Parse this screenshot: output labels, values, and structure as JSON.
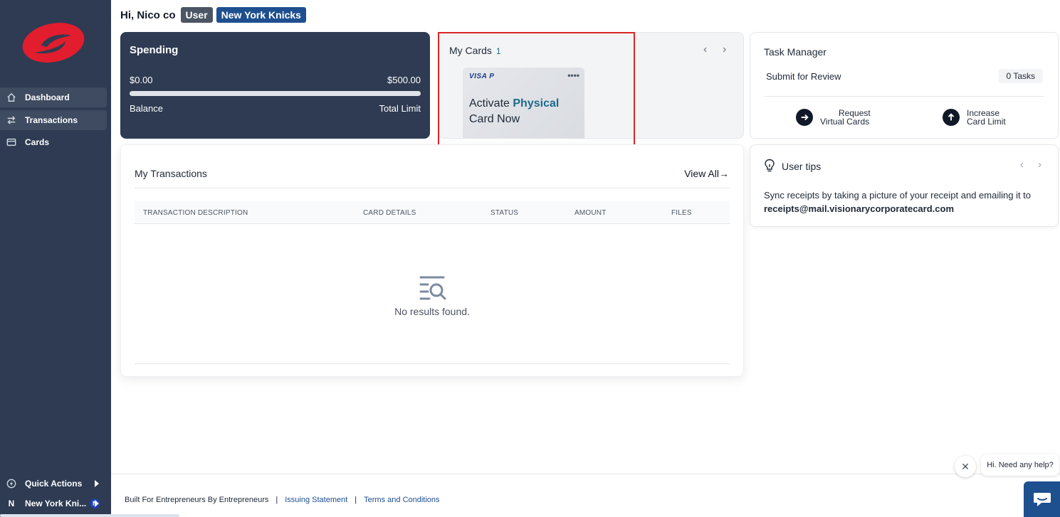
{
  "colors": {
    "sidebar_bg": "#2e3b52",
    "brand_red": "#e11d2e",
    "accent_blue": "#1e4f8f",
    "highlight_red": "#dc2626"
  },
  "sidebar": {
    "items": [
      {
        "label": "Dashboard",
        "icon": "home-icon",
        "active": true
      },
      {
        "label": "Transactions",
        "icon": "transfer-arrows-icon",
        "active": true
      },
      {
        "label": "Cards",
        "icon": "credit-card-icon",
        "active": false
      }
    ],
    "quick_actions": "Quick Actions",
    "org_label": "New York Kni...",
    "org_initial": "N",
    "org_badge": "N"
  },
  "header": {
    "greeting": "Hi, Nico co",
    "role_badge": "User",
    "team_badge": "New York Knicks"
  },
  "spending": {
    "title": "Spending",
    "balance_value": "$0.00",
    "limit_value": "$500.00",
    "balance_label": "Balance",
    "limit_label": "Total Limit",
    "used_fraction": 0
  },
  "my_cards": {
    "title": "My Cards",
    "count": "1",
    "card": {
      "brand": "VISA P",
      "masked": "••••",
      "line1_prefix": "Activate",
      "line1_highlight": "Physical",
      "line2": "Card Now"
    }
  },
  "task_manager": {
    "title": "Task Manager",
    "row_label": "Submit for Review",
    "tasks_count": "0 Tasks",
    "actions": [
      {
        "line1": "Request",
        "line2": "Virtual Cards"
      },
      {
        "line1": "Increase",
        "line2": "Card Limit"
      }
    ]
  },
  "transactions": {
    "title": "My Transactions",
    "view_all": "View All",
    "columns": [
      "TRANSACTION DESCRIPTION",
      "CARD DETAILS",
      "STATUS",
      "AMOUNT",
      "FILES"
    ],
    "empty_text": "No results found."
  },
  "tips": {
    "title": "User tips",
    "body": "Sync receipts by taking a picture of your receipt and emailing it to",
    "email": "receipts@mail.visionarycorporatecard.com"
  },
  "footer": {
    "tagline": "Built For Entrepreneurs By Entrepreneurs",
    "link1": "Issuing Statement",
    "link2": "Terms and Conditions",
    "separator": "|"
  },
  "chat": {
    "bubble": "Hi. Need any help?",
    "close": "✕"
  }
}
